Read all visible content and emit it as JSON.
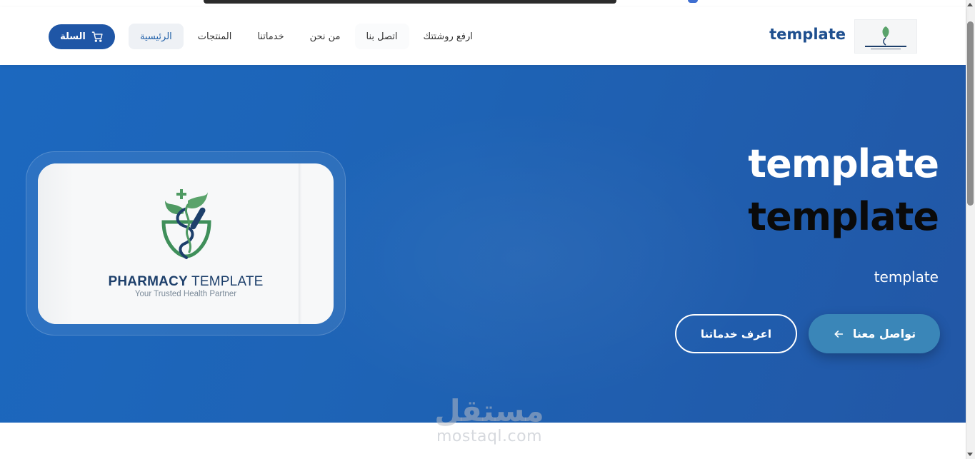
{
  "header": {
    "brand": "template",
    "nav": [
      {
        "label": "الرئيسية",
        "active": true
      },
      {
        "label": "المنتجات"
      },
      {
        "label": "خدماتنا"
      },
      {
        "label": "من نحن"
      },
      {
        "label": "اتصل بنا"
      },
      {
        "label": "ارفع روشتتك"
      }
    ],
    "cart_label": "السلة"
  },
  "hero": {
    "title_line1": "template",
    "title_line2": "template",
    "subtitle": "template",
    "primary_button": "تواصل معنا",
    "secondary_button": "اعرف خدماتنا",
    "card": {
      "title_bold": "PHARMACY",
      "title_light": "TEMPLATE",
      "tagline": "Your Trusted Health Partner"
    }
  },
  "watermark": {
    "arabic": "مستقل",
    "latin": "mostaql.com"
  },
  "colors": {
    "brand": "#1e4f8f",
    "hero_bg": "#1e63b5",
    "primary_button": "#3a86b8",
    "cart_button": "#1f56a6"
  },
  "icons": {
    "cart": "cart-icon",
    "arrow": "arrow-left-icon",
    "logo": "pharmacy-logo-icon"
  }
}
